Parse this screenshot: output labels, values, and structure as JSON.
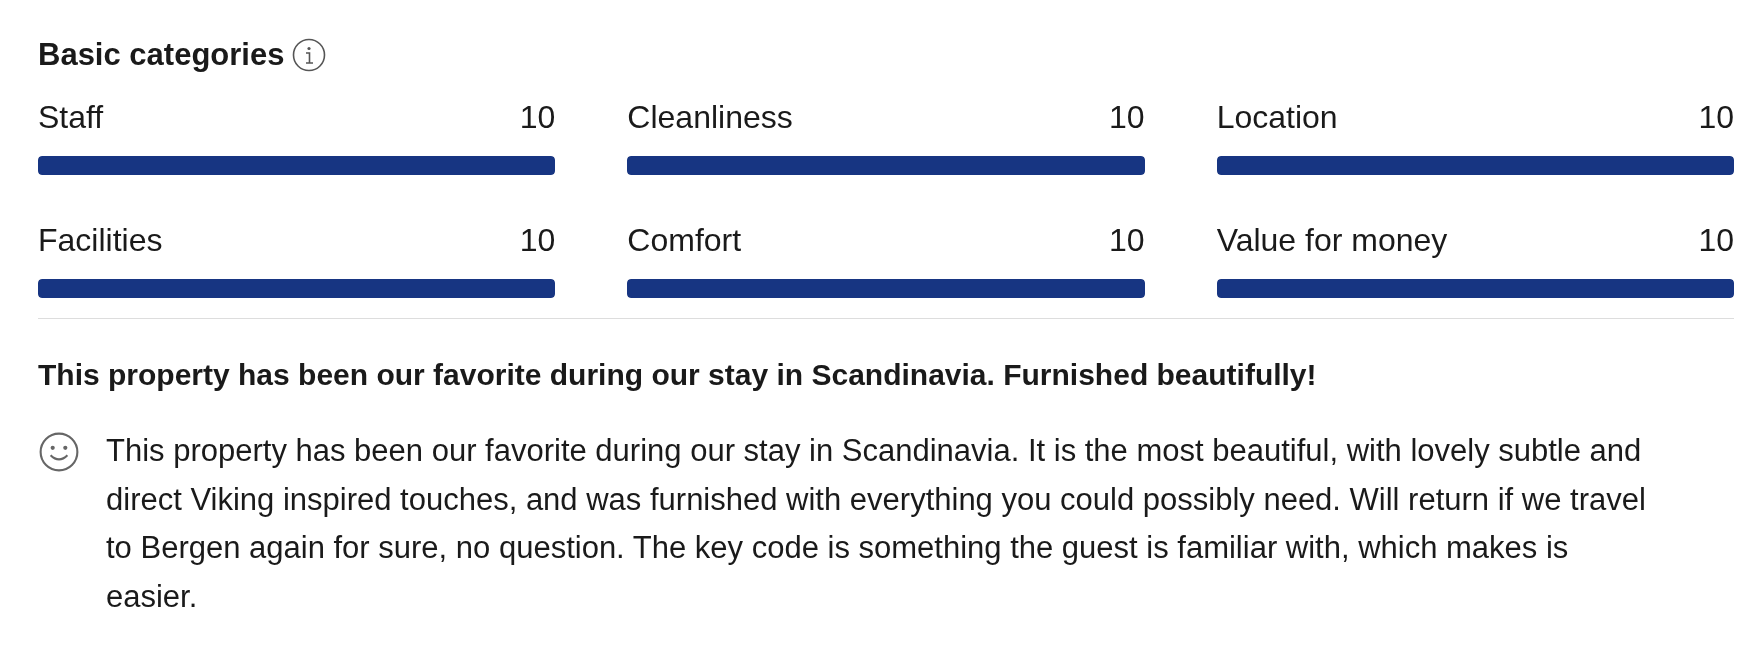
{
  "section": {
    "title": "Basic categories"
  },
  "categories": [
    {
      "label": "Staff",
      "score": "10",
      "level": 1
    },
    {
      "label": "Cleanliness",
      "score": "10",
      "level": 1
    },
    {
      "label": "Location",
      "score": "10",
      "level": 1
    },
    {
      "label": "Facilities",
      "score": "10",
      "level": 1
    },
    {
      "label": "Comfort",
      "score": "10",
      "level": 1
    },
    {
      "label": "Value for money",
      "score": "10",
      "level": 1
    }
  ],
  "review": {
    "title": "This property has been our favorite during our stay in Scandinavia. Furnished beautifully!",
    "kind": "positive",
    "text": "This property has been our favorite during our stay in Scandinavia. It is the most beautiful, with lovely subtle and direct Viking inspired touches, and was furnished with everything you could possibly need. Will return if we travel to Bergen again for sure, no question. The key code is something the guest is familiar with, which makes is easier."
  }
}
